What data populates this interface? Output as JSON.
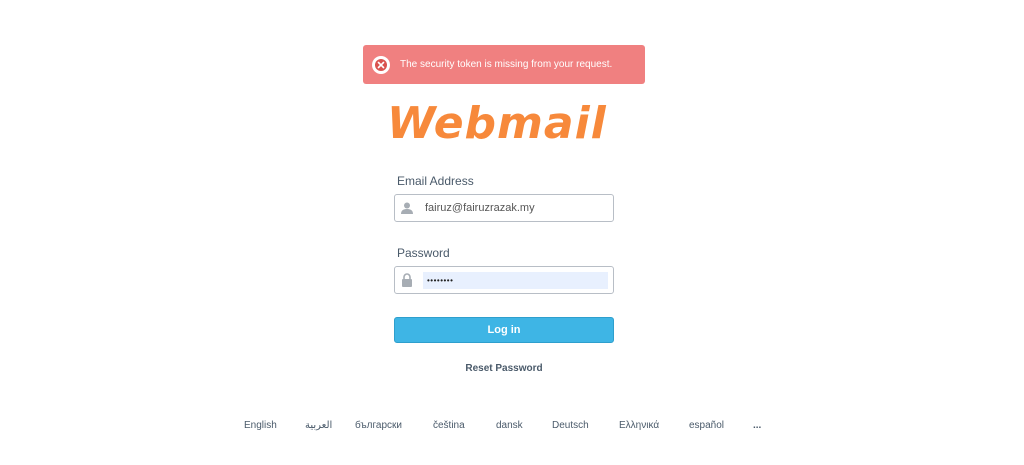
{
  "alert": {
    "message": "The security token is missing from your request.",
    "icon": "error-x-icon",
    "color": "#f08080"
  },
  "logo": {
    "text": "Webmail",
    "color": "#f7893b"
  },
  "form": {
    "email_label": "Email Address",
    "email_value": "fairuz@fairuzrazak.my",
    "password_label": "Password",
    "password_value": "••••••••",
    "login_label": "Log in",
    "reset_label": "Reset Password",
    "login_color": "#3eb5e5"
  },
  "languages": [
    "English",
    "العربية",
    "български",
    "čeština",
    "dansk",
    "Deutsch",
    "Ελληνικά",
    "español",
    "..."
  ]
}
